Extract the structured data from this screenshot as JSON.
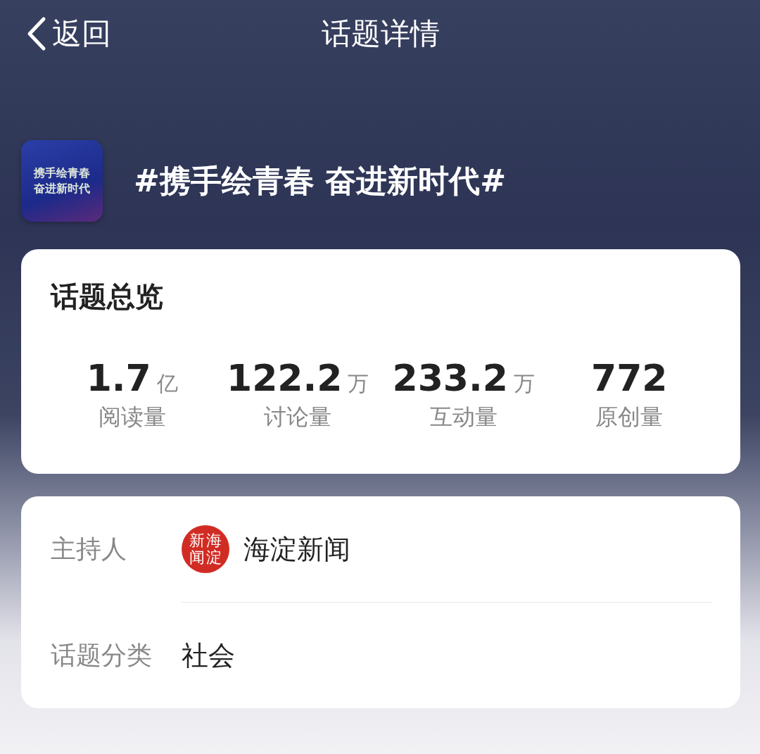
{
  "nav": {
    "back": "返回",
    "title": "话题详情"
  },
  "topic": {
    "cover_lines": [
      "携手绘青春",
      "奋进新时代"
    ],
    "title": "#携手绘青春 奋进新时代#"
  },
  "overview": {
    "heading": "话题总览",
    "stats": [
      {
        "value": "1.7",
        "unit": "亿",
        "label": "阅读量"
      },
      {
        "value": "122.2",
        "unit": "万",
        "label": "讨论量"
      },
      {
        "value": "233.2",
        "unit": "万",
        "label": "互动量"
      },
      {
        "value": "772",
        "label": "原创量"
      }
    ]
  },
  "info": {
    "rows": [
      {
        "kind": "host",
        "label": "主持人",
        "avatar_columns": [
          "新闻",
          "海淀"
        ],
        "value": "海淀新闻"
      },
      {
        "kind": "text",
        "label": "话题分类",
        "value": "社会"
      }
    ]
  }
}
